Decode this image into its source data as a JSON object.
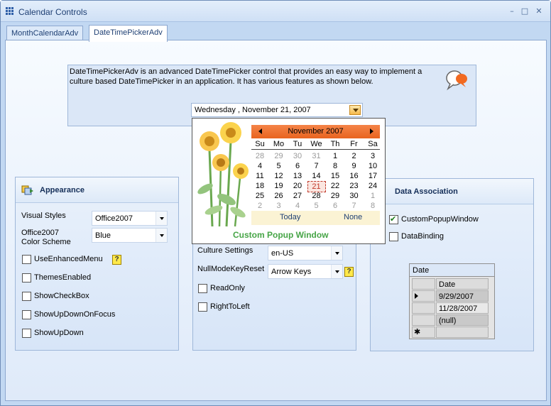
{
  "window": {
    "title": "Calendar Controls",
    "minimize": "–",
    "maximize": "□",
    "close": "✕"
  },
  "tabs": [
    {
      "label": "MonthCalendarAdv"
    },
    {
      "label": "DateTimePickerAdv"
    }
  ],
  "description": "DateTimePickerAdv is an advanced DateTimePicker control that provides an easy way to implement a culture based DateTimePicker in an application. It has various features as shown below.",
  "datetimepicker": {
    "value": "Wednesday ,  November  21, 2007"
  },
  "popup": {
    "month_title": "November   2007",
    "days_of_week": [
      "Su",
      "Mo",
      "Tu",
      "We",
      "Th",
      "Fr",
      "Sa"
    ],
    "weeks": [
      [
        "28",
        "29",
        "30",
        "31",
        "1",
        "2",
        "3"
      ],
      [
        "4",
        "5",
        "6",
        "7",
        "8",
        "9",
        "10"
      ],
      [
        "11",
        "12",
        "13",
        "14",
        "15",
        "16",
        "17"
      ],
      [
        "18",
        "19",
        "20",
        "21",
        "22",
        "23",
        "24"
      ],
      [
        "25",
        "26",
        "27",
        "28",
        "29",
        "30",
        "1"
      ],
      [
        "2",
        "3",
        "4",
        "5",
        "6",
        "7",
        "8"
      ]
    ],
    "today_label": "Today",
    "none_label": "None",
    "caption": "Custom Popup Window",
    "selected_day": "21"
  },
  "appearance": {
    "title": "Appearance",
    "visual_styles_label": "Visual Styles",
    "visual_styles_value": "Office2007",
    "color_scheme_label": "Office2007\nColor Scheme",
    "color_scheme_value": "Blue",
    "options": [
      {
        "label": "UseEnhancedMenu",
        "checked": false
      },
      {
        "label": "ThemesEnabled",
        "checked": false
      },
      {
        "label": "ShowCheckBox",
        "checked": false
      },
      {
        "label": "ShowUpDownOnFocus",
        "checked": false
      },
      {
        "label": "ShowUpDown",
        "checked": false
      }
    ]
  },
  "behavior": {
    "culture_label": "Culture Settings",
    "culture_value": "en-US",
    "nullmode_label": "NullModeKeyReset",
    "nullmode_value": "Arrow Keys",
    "options": [
      {
        "label": "ReadOnly",
        "checked": false
      },
      {
        "label": "RightToLeft",
        "checked": false
      }
    ]
  },
  "data_association": {
    "title": "Data Association",
    "options": [
      {
        "label": "CustomPopupWindow",
        "checked": true
      },
      {
        "label": "DataBinding",
        "checked": false
      }
    ],
    "grid": {
      "caption": "Date",
      "column": "Date",
      "rows": [
        "9/29/2007",
        "11/28/2007",
        "(null)"
      ],
      "new_row_marker": "✱"
    }
  }
}
